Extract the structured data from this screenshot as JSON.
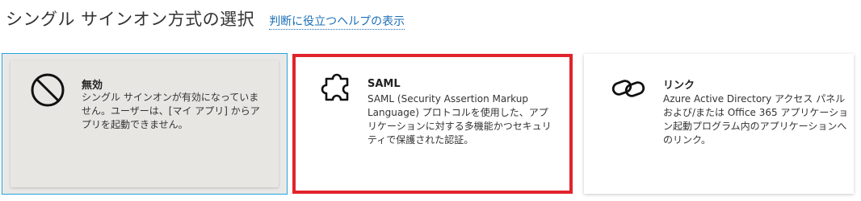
{
  "header": {
    "title": "シングル サインオン方式の選択",
    "help_link": "判断に役立つヘルプの表示"
  },
  "cards": [
    {
      "id": "disabled",
      "icon": "prohibited-icon",
      "name": "無効",
      "description": "シングル サインオンが有効になっていません。ユーザーは、[マイ アプリ] からアプリを起動できません。",
      "selected": false
    },
    {
      "id": "saml",
      "icon": "puzzle-icon",
      "name": "SAML",
      "description": "SAML (Security Assertion Markup Language) プロトコルを使用した、アプリケーションに対する多機能かつセキュリティで保護された認証。",
      "selected": true
    },
    {
      "id": "link",
      "icon": "link-icon",
      "name": "リンク",
      "description": "Azure Active Directory アクセス パネルおよび/または Office 365 アプリケーション起動プログラム内のアプリケーションへのリンク。",
      "selected": false
    }
  ],
  "colors": {
    "help_link": "#1b6fb5",
    "hover_outline": "#23a5de",
    "selected_border": "#e1232c",
    "disabled_card_bg": "#e8e6e3"
  }
}
